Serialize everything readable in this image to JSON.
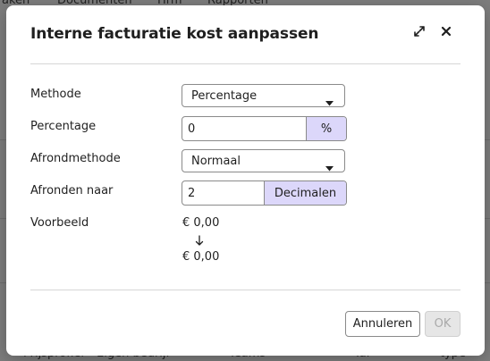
{
  "background": {
    "nav": [
      "aken",
      "Documenten",
      "Hrm",
      "Rapporten"
    ],
    "footer": [
      "Prijsprofiel",
      "Eigen bedrijf",
      "Teams",
      "Tal",
      "type"
    ]
  },
  "dialog": {
    "title": "Interne facturatie kost aanpassen",
    "icons": {
      "expand": "expand-icon",
      "close": "close-icon"
    },
    "fields": {
      "methode": {
        "label": "Methode",
        "value": "Percentage"
      },
      "percentage": {
        "label": "Percentage",
        "value": "0",
        "addon": "%"
      },
      "afrondmethode": {
        "label": "Afrondmethode",
        "value": "Normaal"
      },
      "afronden_naar": {
        "label": "Afronden naar",
        "value": "2",
        "addon": "Decimalen"
      },
      "voorbeeld": {
        "label": "Voorbeeld",
        "from": "€ 0,00",
        "to": "€ 0,00"
      }
    },
    "buttons": {
      "cancel": "Annuleren",
      "ok": "OK"
    }
  },
  "colors": {
    "addon_bg": "#dcd7fa",
    "overlay": "#7d7d7d",
    "ok_disabled_bg": "#e6e6e6"
  }
}
